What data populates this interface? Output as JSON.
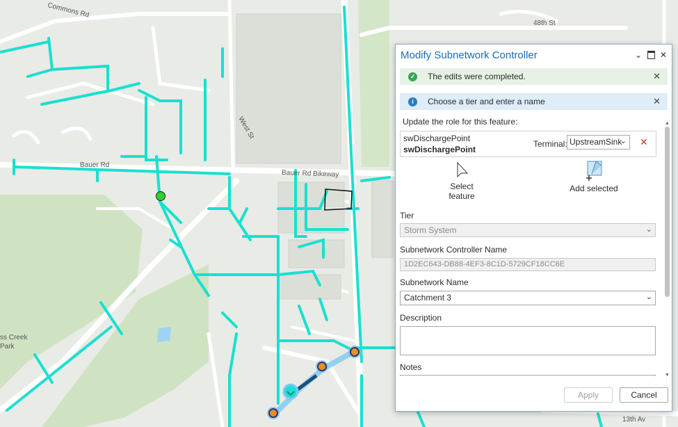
{
  "map": {
    "street_labels": {
      "commons_rd": "Commons Rd",
      "forty_eighth_st": "48th St",
      "west_st": "West St",
      "bauer_rd": "Bauer Rd",
      "bauer_rd_bikeway": "Bauer Rd Bikeway",
      "park_line1": "ss Creek",
      "park_line2": "Park",
      "thirteenth_av": "13th Av"
    },
    "colors": {
      "network": "#19e0d0",
      "background": "#e9ebe6",
      "park": "#cfe3c2",
      "controller_point": "#2fd12f"
    }
  },
  "pane": {
    "title": "Modify Subnetwork Controller",
    "header_icons": [
      "chevron-down-icon",
      "maximize-icon",
      "close-icon"
    ],
    "success_message": "The edits were completed.",
    "info_message": "Choose a tier and enter a name",
    "role_section_label": "Update the role for this feature:",
    "feature_name": "swDischargePoint",
    "feature_name_bold": "swDischargePoint",
    "terminal_label": "Terminal:",
    "terminal_value": "UpstreamSink",
    "select_feature_line1": "Select",
    "select_feature_line2": "feature",
    "add_selected_label": "Add selected",
    "tier_label": "Tier",
    "tier_value": "Storm System",
    "controller_name_label": "Subnetwork Controller Name",
    "controller_name_value": "1D2EC643-DB88-4EF3-8C1D-5729CF18CC6E",
    "subnetwork_name_label": "Subnetwork Name",
    "subnetwork_name_value": "Catchment 3",
    "description_label": "Description",
    "description_value": "",
    "notes_label": "Notes",
    "apply_label": "Apply",
    "cancel_label": "Cancel"
  }
}
